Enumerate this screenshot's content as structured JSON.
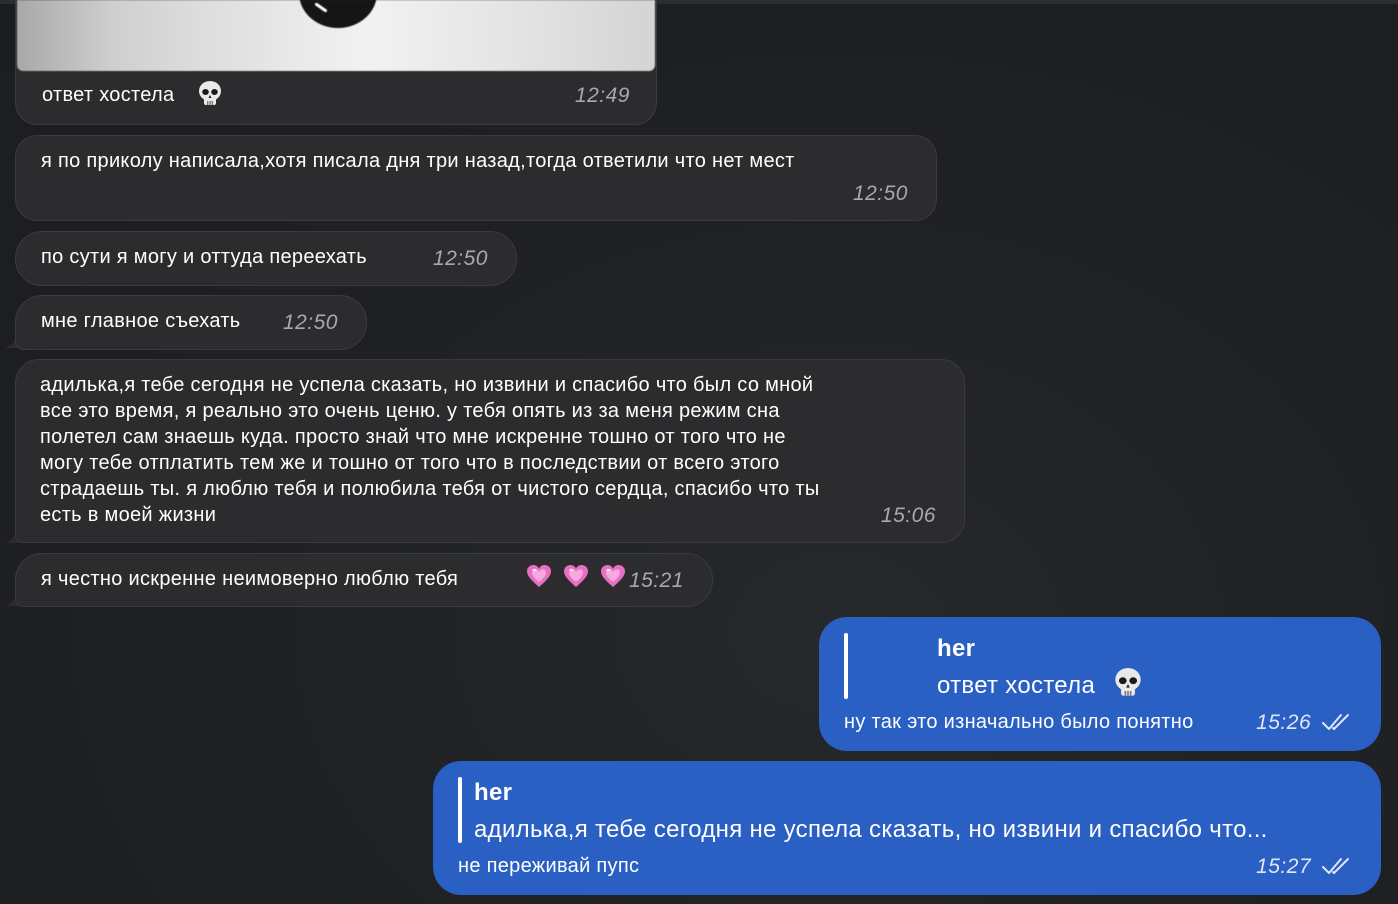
{
  "messages": {
    "m1": {
      "text": "ответ хостела",
      "emoji": "skull",
      "time": "12:49"
    },
    "m2": {
      "text": "я по приколу написала,хотя писала дня три назад,тогда ответили что нет мест",
      "time": "12:50"
    },
    "m3": {
      "text": "по сути я могу и оттуда переехать",
      "time": "12:50"
    },
    "m4": {
      "text": "мне главное съехать",
      "time": "12:50"
    },
    "m5": {
      "lines": [
        "адилька,я тебе сегодня не успела сказать, но извини и спасибо что был со мной",
        "все это время, я реально это очень ценю. у тебя опять из за меня режим сна",
        "полетел сам знаешь куда. просто знай что мне искренне тошно от того что не",
        "могу тебе отплатить тем же и тошно от того что в последствии от всего этого",
        "страдаешь ты. я люблю тебя и полюбила тебя от чистого сердца, спасибо что ты",
        "есть в моей жизни"
      ],
      "time": "15:06"
    },
    "m6": {
      "text": "я честно искренне неимоверно люблю тебя",
      "emoji": "heart-x3",
      "time": "15:21"
    },
    "m7": {
      "reply_name": "her",
      "reply_text": "ответ хостела",
      "reply_emoji": "skull",
      "text": "ну так это изначально было понятно",
      "time": "15:26",
      "status": "read"
    },
    "m8": {
      "reply_name": "her",
      "reply_text": "адилька,я тебе сегодня не успела сказать, но извини и спасибо что...",
      "text": "не переживай пупс",
      "time": "15:27",
      "status": "read"
    }
  },
  "colors": {
    "background": "#1f2124",
    "incoming_bubble": "#2c2c2e",
    "outgoing_bubble": "#2a5fc4",
    "timestamp_in": "#a7a9ad"
  },
  "icons": [
    "skull-emoji-icon",
    "heart-emoji-icon",
    "double-check-icon"
  ]
}
